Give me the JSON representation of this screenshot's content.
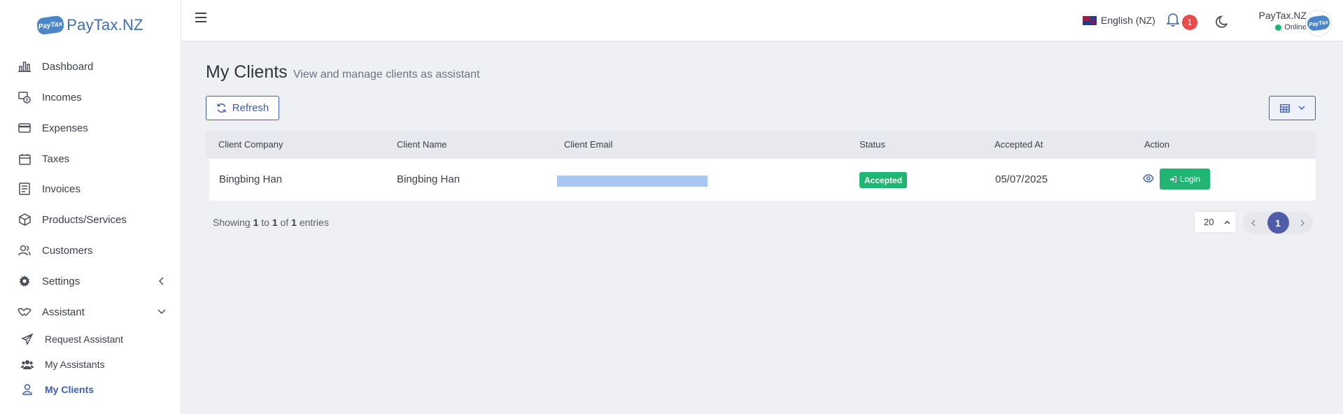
{
  "brand": {
    "name": "PayTax.NZ",
    "logo_text": "PayTax"
  },
  "sidebar": {
    "items": [
      {
        "label": "Dashboard",
        "icon": "bar-chart-icon"
      },
      {
        "label": "Incomes",
        "icon": "income-icon"
      },
      {
        "label": "Expenses",
        "icon": "credit-card-icon"
      },
      {
        "label": "Taxes",
        "icon": "calendar-icon"
      },
      {
        "label": "Invoices",
        "icon": "invoice-icon"
      },
      {
        "label": "Products/Services",
        "icon": "box-icon"
      },
      {
        "label": "Customers",
        "icon": "users-icon"
      },
      {
        "label": "Settings",
        "icon": "gear-icon"
      },
      {
        "label": "Assistant",
        "icon": "handshake-icon"
      }
    ],
    "sub_items": [
      {
        "label": "Request Assistant",
        "icon": "paper-plane-icon"
      },
      {
        "label": "My Assistants",
        "icon": "group-icon"
      },
      {
        "label": "My Clients",
        "icon": "user-icon",
        "active": true
      }
    ]
  },
  "topbar": {
    "language": "English (NZ)",
    "notification_count": "1",
    "user_name": "PayTax.NZ",
    "user_status": "Online"
  },
  "page": {
    "title": "My Clients",
    "subtitle": "View and manage clients as assistant",
    "refresh_label": "Refresh"
  },
  "table": {
    "columns": [
      "Client Company",
      "Client Name",
      "Client Email",
      "Status",
      "Accepted At",
      "Action"
    ],
    "rows": [
      {
        "company": "Bingbing Han",
        "name": "Bingbing Han",
        "email": "",
        "status": "Accepted",
        "accepted_at": "05/07/2025",
        "action_label": "Login"
      }
    ]
  },
  "footer": {
    "showing_prefix": "Showing",
    "from": "1",
    "to_word": "to",
    "to": "1",
    "of_word": "of",
    "total": "1",
    "suffix": "entries",
    "page_size": "20",
    "current_page": "1"
  },
  "colors": {
    "accent": "#3f5fb0",
    "success": "#21b573",
    "danger": "#e84b4b",
    "background": "#eef0f4"
  }
}
